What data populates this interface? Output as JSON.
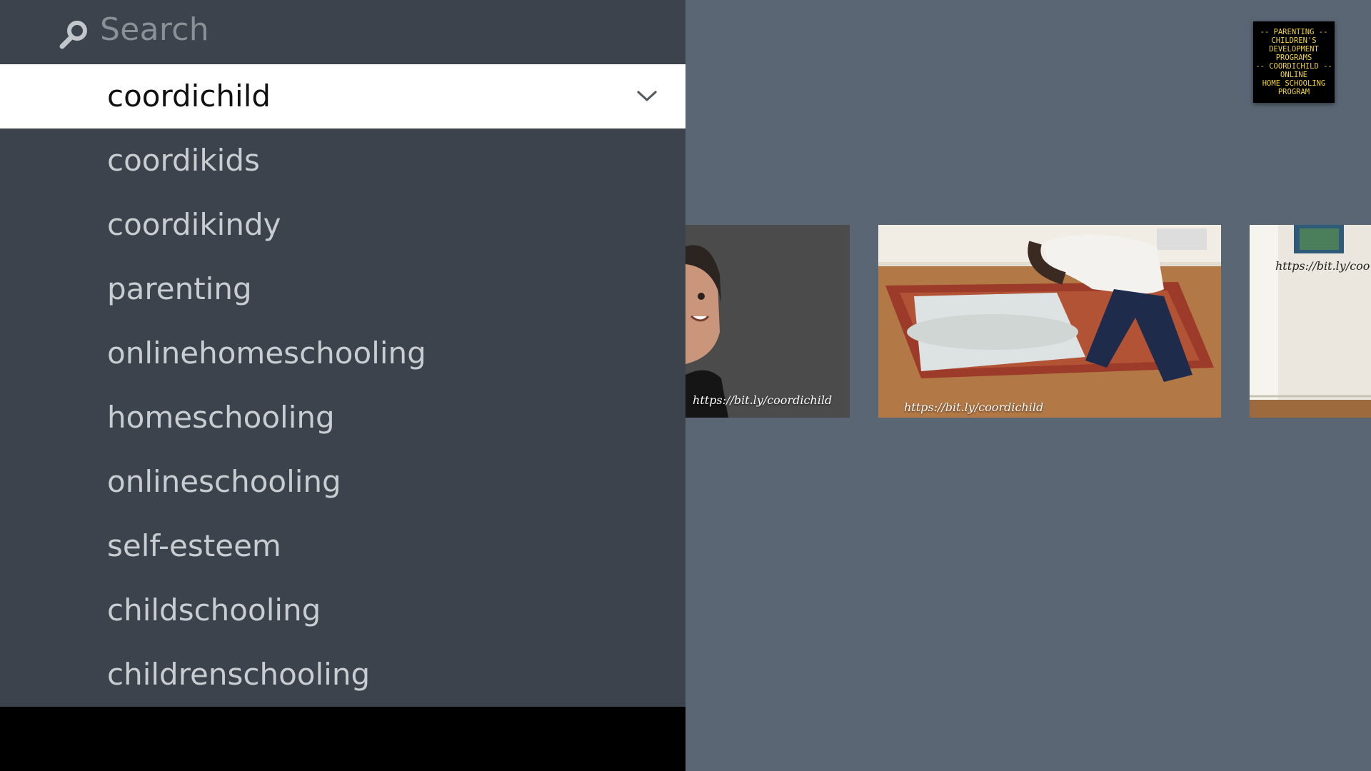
{
  "search": {
    "placeholder": "Search"
  },
  "suggestions": [
    {
      "label": "coordichild",
      "selected": true
    },
    {
      "label": "coordikids",
      "selected": false
    },
    {
      "label": "coordikindy",
      "selected": false
    },
    {
      "label": "parenting",
      "selected": false
    },
    {
      "label": "onlinehomeschooling",
      "selected": false
    },
    {
      "label": "homeschooling",
      "selected": false
    },
    {
      "label": "onlineschooling",
      "selected": false
    },
    {
      "label": "self-esteem",
      "selected": false
    },
    {
      "label": "childschooling",
      "selected": false
    },
    {
      "label": "childrenschooling",
      "selected": false
    }
  ],
  "channel_logo": {
    "lines": [
      "-- PARENTING --",
      "CHILDREN'S",
      "DEVELOPMENT",
      "PROGRAMS",
      "-- COORDICHILD --",
      "ONLINE",
      "HOME SCHOOLING",
      "PROGRAM"
    ]
  },
  "videos": [
    {
      "caption": "https://bit.ly/coordichild"
    },
    {
      "caption": "https://bit.ly/coordichild"
    },
    {
      "caption": "https://bit.ly/coo"
    }
  ],
  "colors": {
    "panel_bg": "#3c434c",
    "content_bg": "#5b6674",
    "selected_bg": "#ffffff",
    "logo_text": "#f2d43a"
  },
  "icons": {
    "search": "search-icon",
    "dropdown": "chevron-down-icon"
  }
}
